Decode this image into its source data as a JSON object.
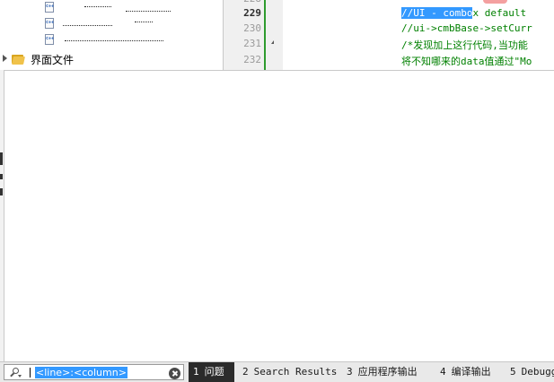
{
  "project_tree": {
    "files": [
      {
        "icon": "cpp-file-icon",
        "label": "c++"
      },
      {
        "icon": "cpp-file-icon",
        "label": "c++"
      },
      {
        "icon": "cpp-file-icon",
        "label": "c++"
      }
    ],
    "folder": {
      "icon": "folder-icon",
      "label": "界面文件"
    }
  },
  "editor": {
    "lines": [
      {
        "number": "228",
        "text": ""
      },
      {
        "number": "229",
        "text_selected": "//UI - combo",
        "text_rest": "x default",
        "current": true
      },
      {
        "number": "230",
        "text": "//ui->cmbBase->setCurr"
      },
      {
        "number": "231",
        "text": "/*发现加上这行代码,当功能"
      },
      {
        "number": "232",
        "text": "将不知哪来的data值通过\"Mo"
      }
    ]
  },
  "bottom_bar": {
    "locator": {
      "icon": "search-icon",
      "value": "<line>:<column>",
      "clear_icon": "clear-icon"
    },
    "tabs": [
      {
        "number": "1",
        "label": "问题",
        "active": true
      },
      {
        "number": "2",
        "label": "Search Results",
        "active": false
      },
      {
        "number": "3",
        "label": "应用程序输出",
        "active": false
      },
      {
        "number": "4",
        "label": "编译输出",
        "active": false
      },
      {
        "number": "5",
        "label": "Debugg",
        "active": false
      }
    ]
  },
  "colors": {
    "selection": "#3399ff",
    "comment_green": "#008000",
    "change_bar": "#2e9b2e",
    "active_tab": "#2b2b2b"
  }
}
